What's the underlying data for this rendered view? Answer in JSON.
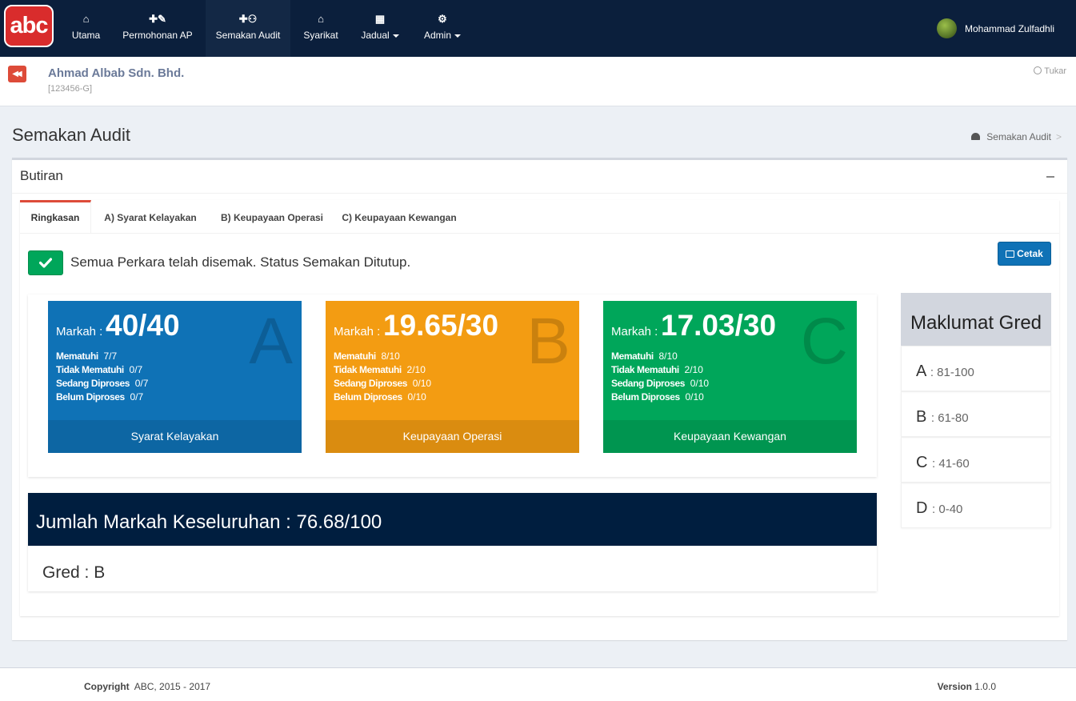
{
  "app": {
    "logo_text": "abc"
  },
  "nav": {
    "items": [
      {
        "label": "Utama",
        "icon": "home-icon",
        "glyph": "⌂"
      },
      {
        "label": "Permohonan AP",
        "icon": "plus-pencil-icon",
        "glyph": "✚✎"
      },
      {
        "label": "Semakan Audit",
        "icon": "plus-binoculars-icon",
        "glyph": "✚⚇"
      },
      {
        "label": "Syarikat",
        "icon": "bank-icon",
        "glyph": "⌂"
      },
      {
        "label": "Jadual",
        "icon": "calendar-icon",
        "glyph": "▦"
      },
      {
        "label": "Admin",
        "icon": "cogs-icon",
        "glyph": "⚙"
      }
    ],
    "user_name": "Mohammad Zulfadhli"
  },
  "company": {
    "name": "Ahmad Albab Sdn. Bhd.",
    "id": "[123456-G]",
    "switch_label": "Tukar"
  },
  "page": {
    "title": "Semakan Audit",
    "breadcrumb": "Semakan Audit"
  },
  "panel": {
    "title": "Butiran"
  },
  "tabs": [
    "Ringkasan",
    "A) Syarat Kelayakan",
    "B) Keupayaan Operasi",
    "C) Keupayaan Kewangan"
  ],
  "status": {
    "message": "Semua Perkara telah disemak. Status Semakan Ditutup.",
    "print_label": "Cetak"
  },
  "score_label": "Markah :",
  "stat_labels": {
    "mematuhi": "Mematuhi",
    "tidak": "Tidak Mematuhi",
    "sedang": "Sedang Diproses",
    "belum": "Belum Diproses"
  },
  "sections": [
    {
      "letter": "A",
      "score": "40/40",
      "mematuhi": "7/7",
      "tidak": "0/7",
      "sedang": "0/7",
      "belum": "0/7",
      "title": "Syarat Kelayakan",
      "color": "#0f72b6"
    },
    {
      "letter": "B",
      "score": "19.65/30",
      "mematuhi": "8/10",
      "tidak": "2/10",
      "sedang": "0/10",
      "belum": "0/10",
      "title": "Keupayaan Operasi",
      "color": "#f39c12"
    },
    {
      "letter": "C",
      "score": "17.03/30",
      "mematuhi": "8/10",
      "tidak": "2/10",
      "sedang": "0/10",
      "belum": "0/10",
      "title": "Keupayaan Kewangan",
      "color": "#00a65a"
    }
  ],
  "total": {
    "text": "Jumlah Markah Keseluruhan : 76.68/100",
    "grade": "Gred : B"
  },
  "gred_info": {
    "title": "Maklumat Gred",
    "rows": [
      {
        "letter": "A",
        "range": ": 81-100"
      },
      {
        "letter": "B",
        "range": ": 61-80"
      },
      {
        "letter": "C",
        "range": ": 41-60"
      },
      {
        "letter": "D",
        "range": ": 0-40"
      }
    ]
  },
  "footer": {
    "copyright_label": "Copyright",
    "copyright_text": "ABC, 2015 - 2017",
    "version_label": "Version",
    "version_value": "1.0.0"
  }
}
